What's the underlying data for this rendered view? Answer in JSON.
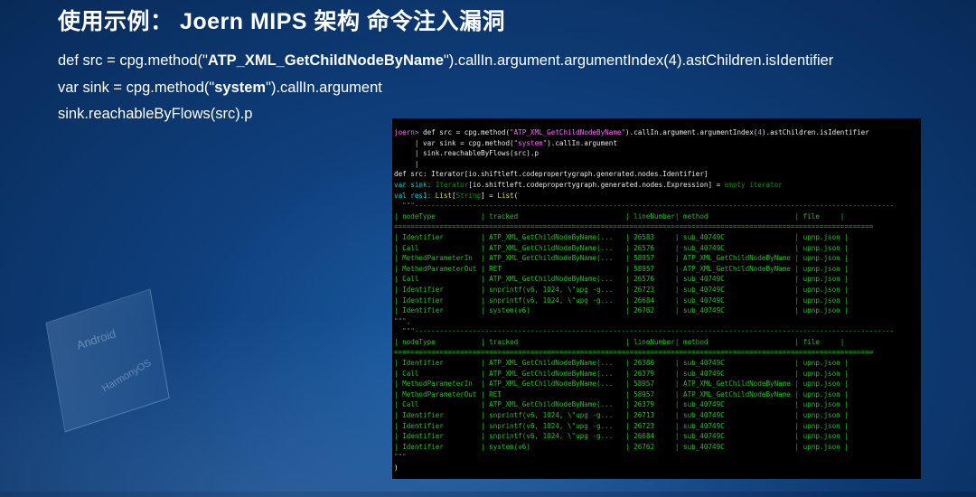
{
  "title": "使用示例： Joern MIPS 架构 命令注入漏洞",
  "code": {
    "line1_pre": "def src = cpg.method(\"",
    "line1_bold": "ATP_XML_GetChildNodeByName",
    "line1_post": "\").callIn.argument.argumentIndex(4).astChildren.isIdentifier",
    "line2_pre": "var sink = cpg.method(\"",
    "line2_bold": "system",
    "line2_post": "\").callIn.argument",
    "line3": "sink.reachableByFlows(src).p"
  },
  "watermark": {
    "a": "Android",
    "b": "HarmonyOS"
  },
  "terminal": {
    "prompt": "joern> ",
    "in1_a": "def src = cpg.method(",
    "in1_str": "\"ATP_XML_GetChildNodeByName\"",
    "in1_b": ").callIn.argument.argumentIndex(",
    "in1_num": "4",
    "in1_c": ").astChildren.isIdentifier",
    "in2_a": "var sink = cpg.method(",
    "in2_str": "\"system\"",
    "in2_b": ").callIn.argument",
    "in3": "sink.reachableByFlows(src).p",
    "out1": "def src: Iterator[io.shiftleft.codepropertygraph.generated.nodes.Identifier]",
    "out2_a": "var sink: ",
    "out2_b": "Iterator",
    "out2_c": "[io.shiftleft.codepropertygraph.generated.nodes.Expression] = ",
    "out2_d": "empty iterator",
    "out3_a": "val res1: ",
    "out3_b": "List",
    "out3_c": "[",
    "out3_d": "String",
    "out3_e": "] = ",
    "out3_f": "List",
    "out3_g": "(",
    "quote_open": "  \"\"\"",
    "dashes": "--------------------------------------------------------------------------------------------------------------------",
    "eqs": "====================================================================================================================",
    "header": "| nodeType           | tracked                          | lineNumber| method                     | file     |",
    "table1": [
      "| Identifier         | ATP_XML_GetChildNodeByName(...   | 26583     | sub_40749C                 | upnp.json |",
      "| Call               | ATP_XML_GetChildNodeByName(...   | 26576     | sub_40749C                 | upnp.json |",
      "| MethodParameterIn  | ATP_XML_GetChildNodeByName(...   | 58957     | ATP_XML_GetChildNodeByName | upnp.json |",
      "| MethodParameterOut | RET                              | 58957     | ATP_XML_GetChildNodeByName | upnp.json |",
      "| Call               | ATP_XML_GetChildNodeByName(...   | 26576     | sub_40749C                 | upnp.json |",
      "| Identifier         | snprintf(v6, 1024, \\\"upg -g...   | 26723     | sub_40749C                 | upnp.json |",
      "| Identifier         | snprintf(v6, 1024, \\\"upg -g...   | 26684     | sub_40749C                 | upnp.json |",
      "| Identifier         | system(v6)                       | 26762     | sub_40749C                 | upnp.json |"
    ],
    "table2": [
      "| Identifier         | ATP_XML_GetChildNodeByName(...   | 26386     | sub_40749C                 | upnp.json |",
      "| Call               | ATP_XML_GetChildNodeByName(...   | 26379     | sub_40749C                 | upnp.json |",
      "| MethodParameterIn  | ATP_XML_GetChildNodeByName(...   | 58957     | ATP_XML_GetChildNodeByName | upnp.json |",
      "| MethodParameterOut | RET                              | 58957     | ATP_XML_GetChildNodeByName | upnp.json |",
      "| Call               | ATP_XML_GetChildNodeByName(...   | 26379     | sub_40749C                 | upnp.json |",
      "| Identifier         | snprintf(v6, 1024, \\\"upg -g...   | 26713     | sub_40749C                 | upnp.json |",
      "| Identifier         | snprintf(v6, 1024, \\\"upg -g...   | 26723     | sub_40749C                 | upnp.json |",
      "| Identifier         | snprintf(v6, 1024, \\\"upg -g...   | 26684     | sub_40749C                 | upnp.json |",
      "| Identifier         | system(v6)                       | 26762     | sub_40749C                 | upnp.json |"
    ],
    "quote_close1": "\"\"\",",
    "quote_close2": "\"\"\"",
    "close_paren": ")"
  },
  "colors": {
    "bg_top": "#082a58",
    "bg_center": "#1b5fa6",
    "terminal_bg": "#000000",
    "prompt": "#ff66ff",
    "keyword": "#ff66ff",
    "identifier": "#00d0d0",
    "string": "#ff66ff",
    "table_text": "#1fc21f"
  }
}
